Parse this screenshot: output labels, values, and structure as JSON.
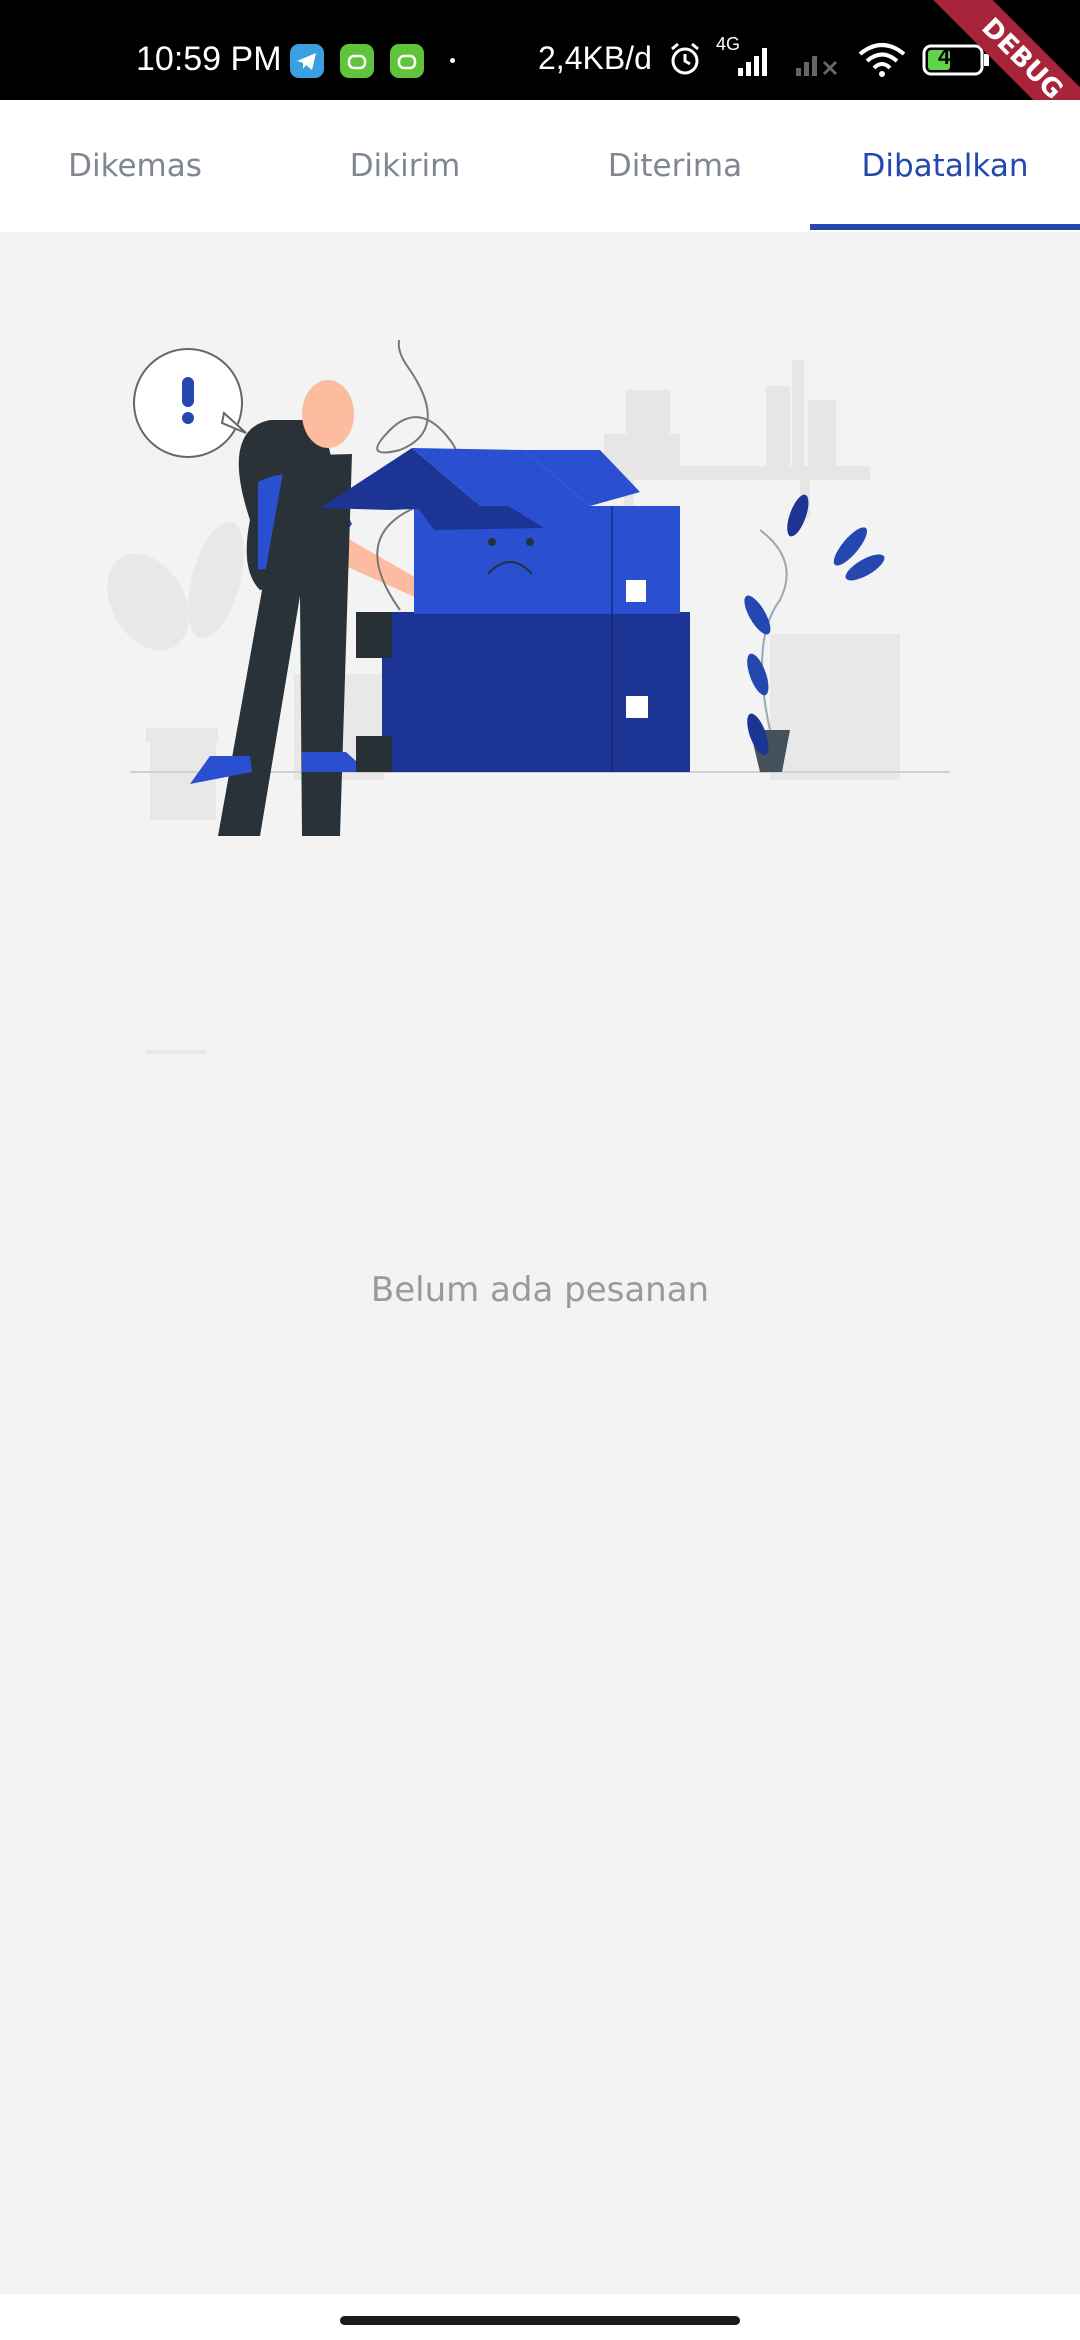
{
  "status_bar": {
    "time": "10:59 PM",
    "network_speed": "2,4KB/d",
    "network_type": "4G",
    "battery_level": "41",
    "debug_label": "DEBUG",
    "icons": [
      "telegram-icon",
      "android-app-icon",
      "android-app-icon",
      "alarm-icon",
      "signal-icon",
      "wifi-icon",
      "battery-icon"
    ]
  },
  "tabs": [
    {
      "label": "Dikemas",
      "active": false
    },
    {
      "label": "Dikirim",
      "active": false
    },
    {
      "label": "Diterima",
      "active": false
    },
    {
      "label": "Dibatalkan",
      "active": true
    }
  ],
  "colors": {
    "accent": "#2448b0",
    "background": "#f3f3f3",
    "tab_inactive": "#808792",
    "empty_text": "#9a9a9a"
  },
  "empty_state": {
    "illustration": "empty-orders-illustration",
    "message": "Belum ada pesanan"
  }
}
